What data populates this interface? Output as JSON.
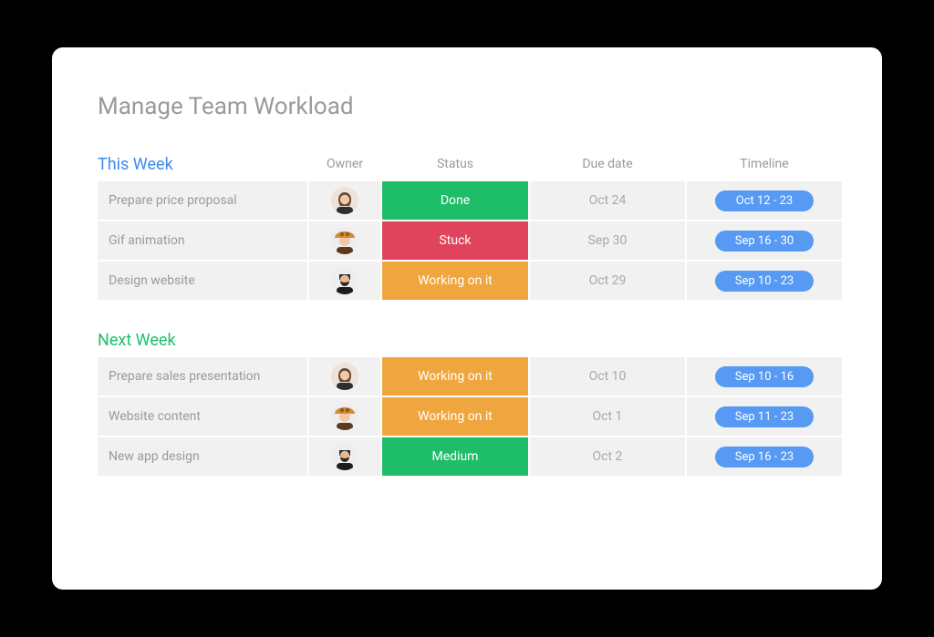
{
  "title": "Manage Team Workload",
  "columns": {
    "owner": "Owner",
    "status": "Status",
    "due": "Due date",
    "timeline": "Timeline"
  },
  "avatars": {
    "woman_brown": "woman-brown-hair",
    "woman_hat": "woman-orange-hat",
    "man_beard": "man-beard"
  },
  "status_colors": {
    "green": "#1EBD68",
    "red": "#E0445D",
    "orange": "#F0A63E"
  },
  "sections": [
    {
      "title": "This Week",
      "color_class": "blue",
      "rows": [
        {
          "task": "Prepare price proposal",
          "owner": "woman_brown",
          "status": "Done",
          "status_class": "status-green",
          "due": "Oct 24",
          "timeline": "Oct 12 - 23"
        },
        {
          "task": "Gif animation",
          "owner": "woman_hat",
          "status": "Stuck",
          "status_class": "status-red",
          "due": "Sep 30",
          "timeline": "Sep 16 - 30"
        },
        {
          "task": "Design website",
          "owner": "man_beard",
          "status": "Working on it",
          "status_class": "status-orange",
          "due": "Oct 29",
          "timeline": "Sep 10 - 23"
        }
      ]
    },
    {
      "title": "Next Week",
      "color_class": "green",
      "rows": [
        {
          "task": "Prepare sales presentation",
          "owner": "woman_brown",
          "status": "Working on it",
          "status_class": "status-orange",
          "due": "Oct 10",
          "timeline": "Sep 10 - 16"
        },
        {
          "task": "Website content",
          "owner": "woman_hat",
          "status": "Working on it",
          "status_class": "status-orange",
          "due": "Oct 1",
          "timeline": "Sep 11 - 23"
        },
        {
          "task": "New app design",
          "owner": "man_beard",
          "status": "Medium",
          "status_class": "status-green",
          "due": "Oct 2",
          "timeline": "Sep 16 - 23"
        }
      ]
    }
  ]
}
